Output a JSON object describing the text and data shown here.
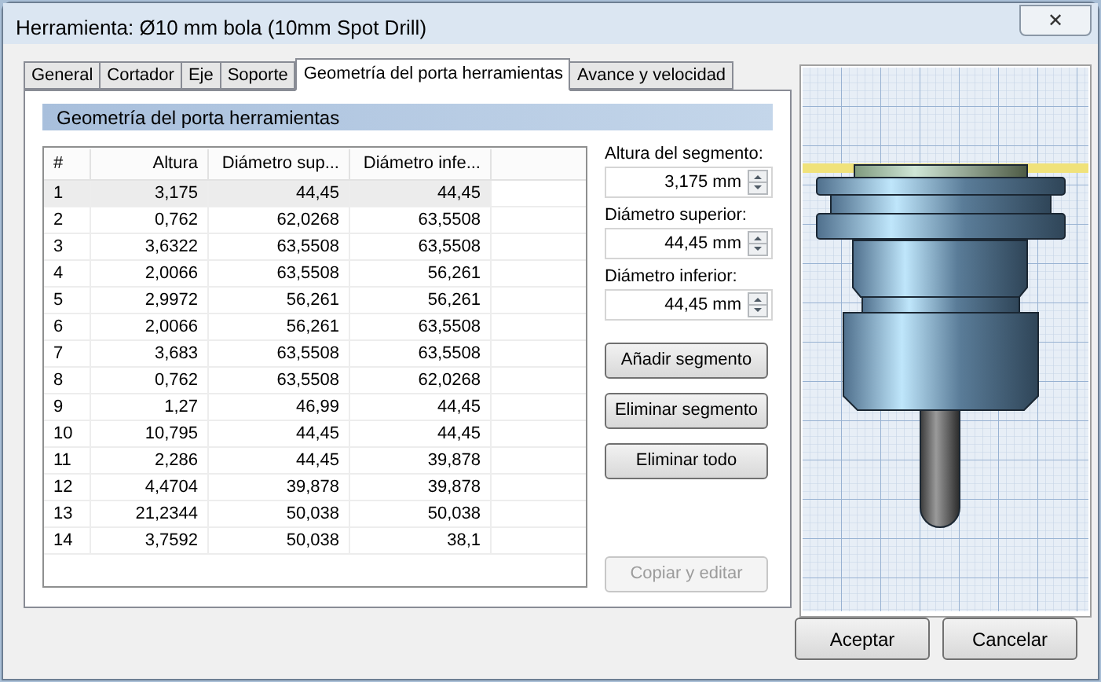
{
  "window": {
    "title": "Herramienta: Ø10 mm bola (10mm Spot Drill)",
    "close": "✕"
  },
  "tabs": [
    {
      "label": "General",
      "selected": false
    },
    {
      "label": "Cortador",
      "selected": false
    },
    {
      "label": "Eje",
      "selected": false
    },
    {
      "label": "Soporte",
      "selected": false
    },
    {
      "label": "Geometría del porta herramientas",
      "selected": true
    },
    {
      "label": "Avance y velocidad",
      "selected": false
    }
  ],
  "section_title": "Geometría del porta herramientas",
  "table": {
    "columns": [
      "#",
      "Altura",
      "Diámetro sup...",
      "Diámetro infe..."
    ],
    "rows": [
      {
        "cells": [
          "1",
          "3,175",
          "44,45",
          "44,45"
        ],
        "selected": true
      },
      {
        "cells": [
          "2",
          "0,762",
          "62,0268",
          "63,5508"
        ],
        "selected": false
      },
      {
        "cells": [
          "3",
          "3,6322",
          "63,5508",
          "63,5508"
        ],
        "selected": false
      },
      {
        "cells": [
          "4",
          "2,0066",
          "63,5508",
          "56,261"
        ],
        "selected": false
      },
      {
        "cells": [
          "5",
          "2,9972",
          "56,261",
          "56,261"
        ],
        "selected": false
      },
      {
        "cells": [
          "6",
          "2,0066",
          "56,261",
          "63,5508"
        ],
        "selected": false
      },
      {
        "cells": [
          "7",
          "3,683",
          "63,5508",
          "63,5508"
        ],
        "selected": false
      },
      {
        "cells": [
          "8",
          "0,762",
          "63,5508",
          "62,0268"
        ],
        "selected": false
      },
      {
        "cells": [
          "9",
          "1,27",
          "46,99",
          "44,45"
        ],
        "selected": false
      },
      {
        "cells": [
          "10",
          "10,795",
          "44,45",
          "44,45"
        ],
        "selected": false
      },
      {
        "cells": [
          "11",
          "2,286",
          "44,45",
          "39,878"
        ],
        "selected": false
      },
      {
        "cells": [
          "12",
          "4,4704",
          "39,878",
          "39,878"
        ],
        "selected": false
      },
      {
        "cells": [
          "13",
          "21,2344",
          "50,038",
          "50,038"
        ],
        "selected": false
      },
      {
        "cells": [
          "14",
          "3,7592",
          "50,038",
          "38,1"
        ],
        "selected": false
      }
    ]
  },
  "fields": [
    {
      "label": "Altura del segmento:",
      "value": "3,175 mm"
    },
    {
      "label": "Diámetro superior:",
      "value": "44,45 mm"
    },
    {
      "label": "Diámetro inferior:",
      "value": "44,45 mm"
    }
  ],
  "actions": [
    {
      "label": "Añadir segmento",
      "disabled": false
    },
    {
      "label": "Eliminar segmento",
      "disabled": false
    },
    {
      "label": "Eliminar todo",
      "disabled": false
    },
    {
      "label": "Copiar y editar",
      "disabled": true
    }
  ],
  "buttons": [
    "Aceptar",
    "Cancelar"
  ]
}
